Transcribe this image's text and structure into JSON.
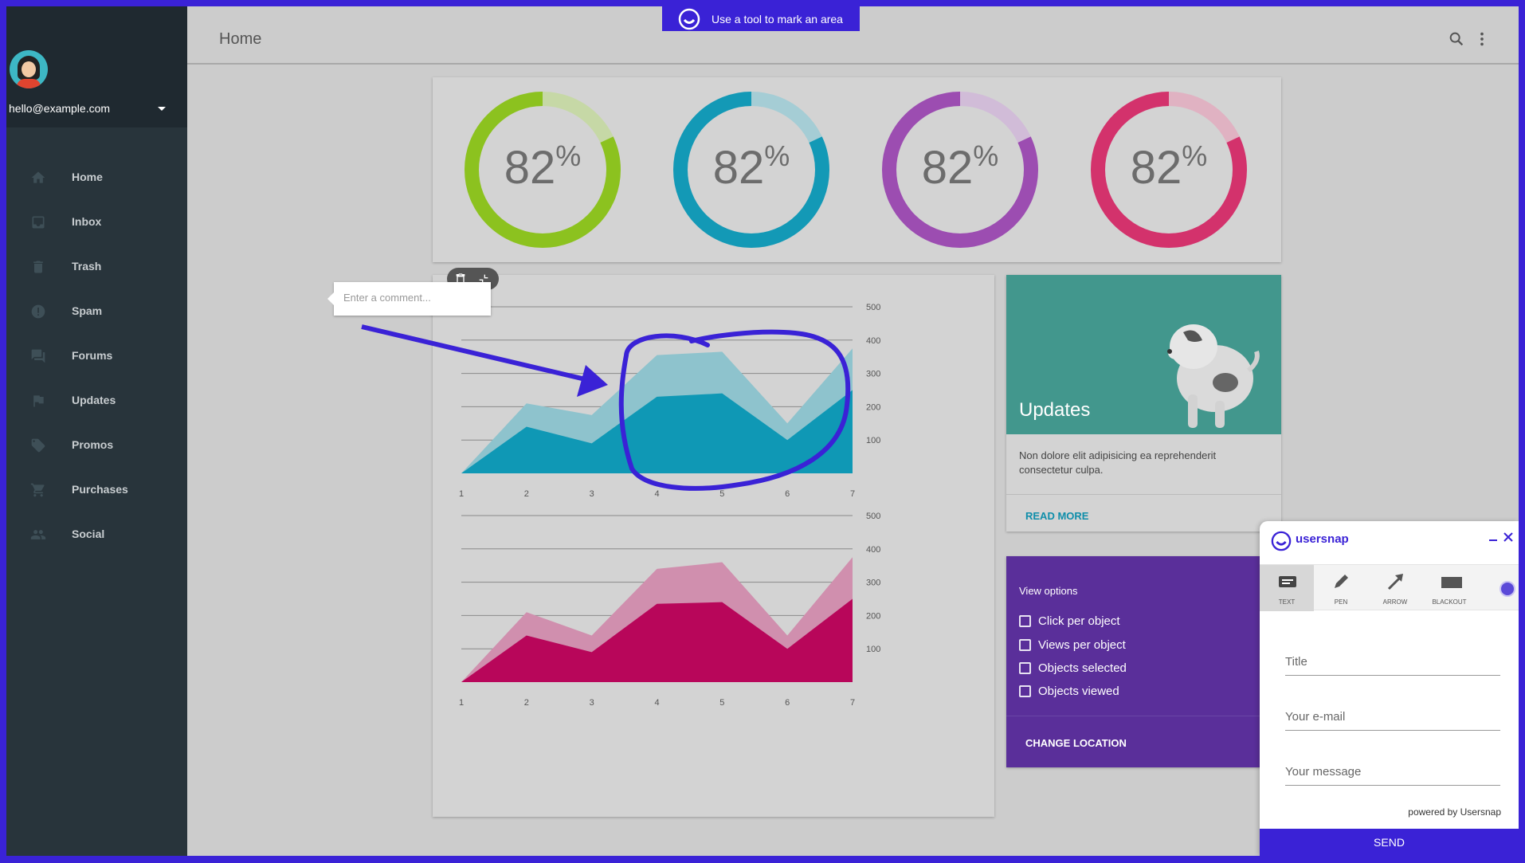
{
  "sidebar": {
    "email": "hello@example.com",
    "items": [
      {
        "label": "Home",
        "icon": "home-icon"
      },
      {
        "label": "Inbox",
        "icon": "inbox-icon"
      },
      {
        "label": "Trash",
        "icon": "trash-icon"
      },
      {
        "label": "Spam",
        "icon": "spam-icon"
      },
      {
        "label": "Forums",
        "icon": "forum-icon"
      },
      {
        "label": "Updates",
        "icon": "flag-icon"
      },
      {
        "label": "Promos",
        "icon": "tag-icon"
      },
      {
        "label": "Purchases",
        "icon": "cart-icon"
      },
      {
        "label": "Social",
        "icon": "people-icon"
      }
    ]
  },
  "appbar": {
    "title": "Home"
  },
  "banner": {
    "text": "Use a tool to mark an area"
  },
  "donuts": [
    {
      "value": "82",
      "unit": "%",
      "color": "#8cc21f",
      "track": "#c6d8a6"
    },
    {
      "value": "82",
      "unit": "%",
      "color": "#1399b6",
      "track": "#a5cdd5"
    },
    {
      "value": "82",
      "unit": "%",
      "color": "#9c4db1",
      "track": "#d1bcd8"
    },
    {
      "value": "82",
      "unit": "%",
      "color": "#d3326c",
      "track": "#e0b2c2"
    }
  ],
  "chart_data": [
    {
      "type": "area",
      "x": [
        1,
        2,
        3,
        4,
        5,
        6,
        7
      ],
      "xlabels": [
        "1",
        "2",
        "3",
        "4",
        "5",
        "6",
        "7"
      ],
      "yticks": [
        "500",
        "400",
        "300",
        "200",
        "100"
      ],
      "ylim": [
        0,
        500
      ],
      "series": [
        {
          "values": [
            0,
            210,
            175,
            355,
            365,
            150,
            375
          ],
          "color": "#8ec3cd"
        },
        {
          "values": [
            0,
            140,
            90,
            230,
            240,
            100,
            250
          ],
          "color": "#0f98b5"
        }
      ]
    },
    {
      "type": "area",
      "x": [
        1,
        2,
        3,
        4,
        5,
        6,
        7
      ],
      "xlabels": [
        "1",
        "2",
        "3",
        "4",
        "5",
        "6",
        "7"
      ],
      "yticks": [
        "500",
        "400",
        "300",
        "200",
        "100"
      ],
      "ylim": [
        0,
        500
      ],
      "series": [
        {
          "values": [
            0,
            210,
            140,
            340,
            360,
            140,
            375
          ],
          "color": "#d08fae"
        },
        {
          "values": [
            0,
            140,
            90,
            235,
            240,
            100,
            250
          ],
          "color": "#b8065a"
        }
      ]
    }
  ],
  "updates": {
    "title": "Updates",
    "text": "Non dolore elit adipisicing ea reprehenderit consectetur culpa.",
    "button": "READ MORE"
  },
  "view_options": {
    "title": "View options",
    "options": [
      "Click per object",
      "Views per object",
      "Objects selected",
      "Objects viewed"
    ],
    "button": "CHANGE LOCATION"
  },
  "comment": {
    "placeholder": "Enter a comment..."
  },
  "usersnap": {
    "brand": "usersnap",
    "tools": [
      "TEXT",
      "PEN",
      "ARROW",
      "BLACKOUT"
    ],
    "fields": [
      "Title",
      "Your e-mail",
      "Your message"
    ],
    "powered": "powered by Usersnap",
    "send": "SEND",
    "accent": "#3a22d6"
  }
}
